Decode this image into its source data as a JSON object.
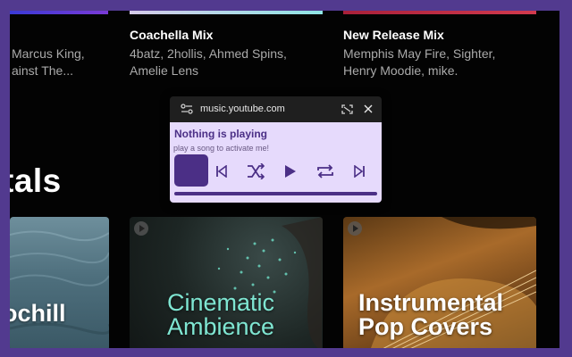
{
  "colors": {
    "frame": "#523a8f",
    "background": "#030303",
    "popup_body": "#e6dafc",
    "popup_accent": "#4b2f86",
    "popup_titlebar": "#1f1f1f"
  },
  "mixes": [
    {
      "title": "",
      "subtitle_line1": "Marcus King,",
      "subtitle_line2": "ainst The..."
    },
    {
      "title": "Coachella Mix",
      "subtitle_line1": "4batz, 2hollis, Ahmed Spins,",
      "subtitle_line2": "Amelie Lens"
    },
    {
      "title": "New Release Mix",
      "subtitle_line1": "Memphis May Fire, Sighter,",
      "subtitle_line2": "Henry Moodie, mike."
    }
  ],
  "section": {
    "title": "tals"
  },
  "cards": [
    {
      "text": "ochill"
    },
    {
      "text_line1": "Cinematic",
      "text_line2": "Ambience"
    },
    {
      "text_line1": "Instrumental",
      "text_line2": "Pop Covers"
    }
  ],
  "mini_player": {
    "domain": "music.youtube.com",
    "status": "Nothing is playing",
    "hint": "play a song to activate me!",
    "icons": [
      "settings-icon",
      "expand-icon",
      "close-icon",
      "previous-icon",
      "shuffle-icon",
      "play-icon",
      "repeat-icon",
      "next-icon"
    ]
  }
}
